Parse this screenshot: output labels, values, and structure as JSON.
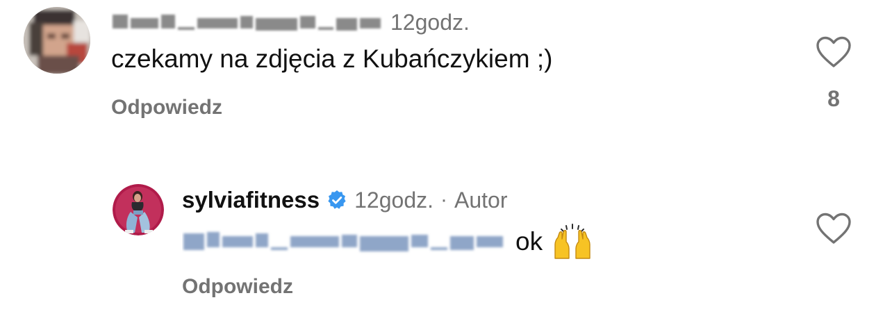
{
  "comments": [
    {
      "username_blurred": true,
      "time": "12godz.",
      "text": "czekamy  na zdjęcia z Kubańczykiem ;)",
      "reply_label": "Odpowiedz",
      "likes": "8"
    },
    {
      "username": "sylviafitness",
      "verified": true,
      "time": "12godz.",
      "separator": "·",
      "author_label": "Autor",
      "mention_blurred": true,
      "text": "ok",
      "emoji": "raising-hands-emoji",
      "reply_label": "Odpowiedz"
    }
  ],
  "colors": {
    "text": "#111111",
    "secondary": "#737373",
    "verified": "#3897f0",
    "mention": "#4a6a9c"
  }
}
